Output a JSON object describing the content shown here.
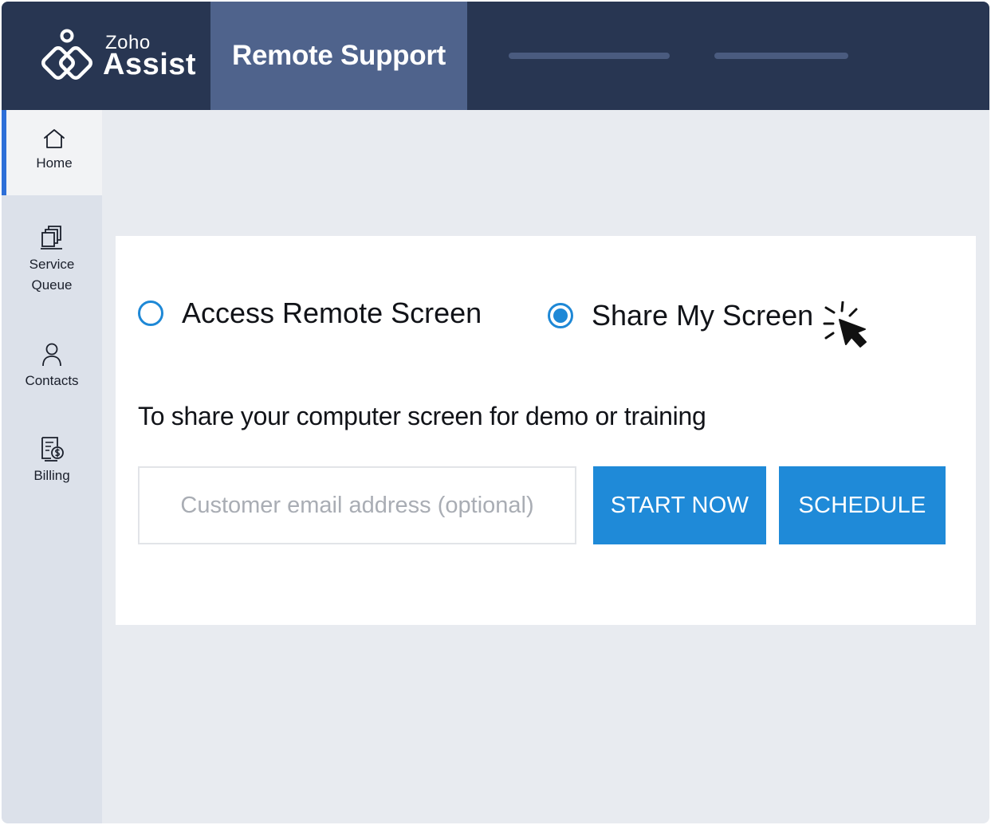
{
  "header": {
    "logo_brand": "Zoho",
    "logo_product": "Assist",
    "active_tab": "Remote Support"
  },
  "sidebar": {
    "items": [
      {
        "label": "Home",
        "icon": "home-icon",
        "active": true
      },
      {
        "label": "Service\nQueue",
        "icon": "service-queue-icon",
        "active": false
      },
      {
        "label": "Contacts",
        "icon": "user-icon",
        "active": false
      },
      {
        "label": "Billing",
        "icon": "billing-icon",
        "active": false
      }
    ]
  },
  "main": {
    "options": [
      {
        "label": "Access Remote Screen",
        "selected": false
      },
      {
        "label": "Share My Screen",
        "selected": true
      }
    ],
    "description": "To share your computer screen for demo or training",
    "email_placeholder": "Customer email address (optional)",
    "start_button": "START NOW",
    "schedule_button": "SCHEDULE"
  },
  "colors": {
    "header_bg": "#283652",
    "active_tab_bg": "#4f638c",
    "sidebar_bg": "#dce1ea",
    "accent": "#1f8ad8",
    "active_indicator": "#2d6fd8"
  }
}
